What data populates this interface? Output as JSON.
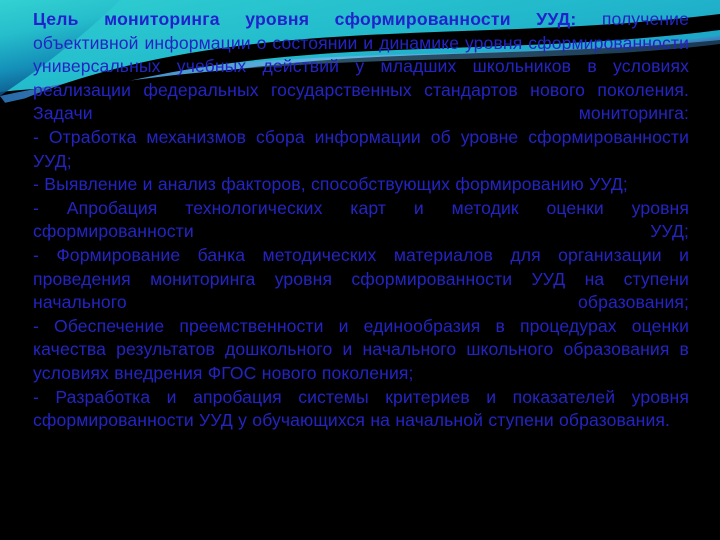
{
  "slide": {
    "background": {
      "base_color": "#000000",
      "band_top_color": "#2ec8c8",
      "band_mid_color": "#1aa6bd",
      "band_deep_color": "#0b4f86",
      "swoosh_color": "#000000",
      "ribbon_color": "#4a9fd8"
    },
    "text_color": "#2424c4",
    "lead_color": "#2222cc",
    "content": {
      "lead_in": "Цель мониторинга уровня сформированности УУД:",
      "paragraphs": [
        "получение объективной информации о состоянии и динамике уровня сформированности универсальных учебных действий у младших школьников в условиях реализации федеральных государственных стандартов нового поколения.",
        "Задачи мониторинга:",
        "- Отработка механизмов сбора информации об уровне сформированности УУД;",
        "- Выявление и анализ факторов, способствующих формированию УУД;",
        "- Апробация технологических карт и методик оценки уровня сформированности УУД;",
        "- Формирование банка методических материалов для организации и проведения мониторинга уровня сформированности УУД на ступени начального образования;",
        "- Обеспечение преемственности и единообразия в процедурах оценки качества результатов дошкольного и начального школьного образования в условиях внедрения ФГОС нового поколения;",
        "- Разработка и апробация системы критериев и показателей уровня сформированности УУД у обучающихся на начальной ступени образования."
      ]
    }
  }
}
